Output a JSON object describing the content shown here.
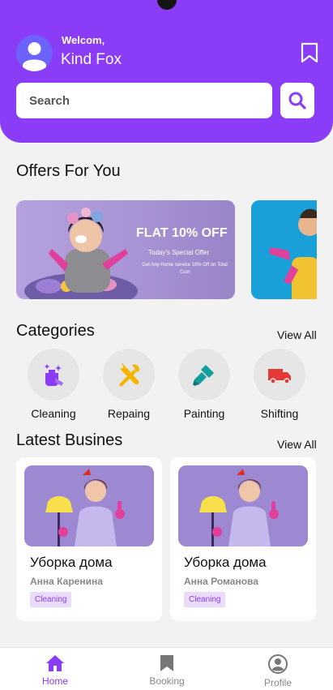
{
  "header": {
    "greeting": "Welcom,",
    "username": "Kind Fox"
  },
  "search": {
    "placeholder": "Search"
  },
  "offers": {
    "title": "Offers For You",
    "cards": [
      {
        "headline": "FLAT 10% OFF",
        "subtitle": "Today's Special Offer",
        "description": "Get Any Home service 10% Off on Total Cost"
      }
    ]
  },
  "categories": {
    "title": "Categories",
    "view_all": "View All",
    "items": [
      {
        "label": "Cleaning",
        "icon": "cleaning-icon",
        "color": "#8b3cf6"
      },
      {
        "label": "Repaing",
        "icon": "tools-icon",
        "color": "#f4b400"
      },
      {
        "label": "Painting",
        "icon": "paint-brush-icon",
        "color": "#129e9e"
      },
      {
        "label": "Shifting",
        "icon": "truck-icon",
        "color": "#e53935"
      }
    ]
  },
  "latest": {
    "title": "Latest Busines",
    "view_all": "View All",
    "items": [
      {
        "title": "Уборка дома",
        "owner": "Анна Каренина",
        "tag": "Cleaning"
      },
      {
        "title": "Уборка дома",
        "owner": "Анна Романова",
        "tag": "Cleaning"
      }
    ]
  },
  "nav": {
    "items": [
      {
        "label": "Home",
        "icon": "home-icon",
        "active": true
      },
      {
        "label": "Booking",
        "icon": "bookmark-icon",
        "active": false
      },
      {
        "label": "Profile",
        "icon": "profile-icon",
        "active": false
      }
    ]
  },
  "colors": {
    "primary": "#8b3cf6",
    "background": "#f2f2f2",
    "tag_background": "#e8dbfc"
  }
}
